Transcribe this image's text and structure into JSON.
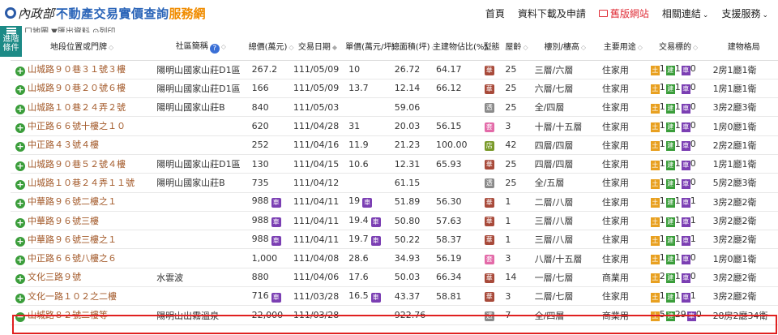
{
  "header": {
    "org": "內政部",
    "title": "不動產交易實價查詢",
    "subtitle": "服務網",
    "nav": [
      {
        "label": "首頁"
      },
      {
        "label": "資料下載及申請"
      },
      {
        "label": "舊版網站"
      },
      {
        "label": "相關連結"
      },
      {
        "label": "支援服務"
      }
    ]
  },
  "filter_tab": {
    "label": "進階條件"
  },
  "toolbar": {
    "label": "口地圖  ▼匯出資料  ⊙列印"
  },
  "columns": [
    "地段位置或門牌",
    "社區簡稱",
    "總價(萬元)",
    "交易日期",
    "單價(萬元/坪)",
    "總面積(坪)",
    "主建物佔比(%)",
    "型態",
    "屋齡",
    "樓別/樓高",
    "主要用途",
    "交易標的",
    "建物格局"
  ],
  "rows": [
    {
      "addr": "山城路９０巷３１號３樓",
      "community": "陽明山國家山莊D1區",
      "price": "267.2",
      "price_car": false,
      "date": "111/05/09",
      "unit": "10",
      "unit_car": false,
      "area": "26.72",
      "ratio": "64.17",
      "type": "華",
      "age": "25",
      "floor": "三層/六層",
      "use": "住家用",
      "t_land": "1",
      "t_bld": "1",
      "t_car": "0",
      "layout": "2房1廳1衛"
    },
    {
      "addr": "山城路９０巷２０號６樓",
      "community": "陽明山國家山莊D1區",
      "price": "166",
      "price_car": false,
      "date": "111/05/09",
      "unit": "13.7",
      "unit_car": false,
      "area": "12.14",
      "ratio": "66.12",
      "type": "華",
      "age": "25",
      "floor": "六層/七層",
      "use": "住家用",
      "t_land": "1",
      "t_bld": "1",
      "t_car": "0",
      "layout": "1房1廳1衛"
    },
    {
      "addr": "山城路１０巷２４弄２號",
      "community": "陽明山國家山莊B",
      "price": "840",
      "price_car": false,
      "date": "111/05/03",
      "unit": "",
      "unit_car": false,
      "area": "59.06",
      "ratio": "",
      "type": "透",
      "age": "25",
      "floor": "全/四層",
      "use": "住家用",
      "t_land": "1",
      "t_bld": "1",
      "t_car": "0",
      "layout": "3房2廳3衛"
    },
    {
      "addr": "中正路６６號十樓之１０",
      "community": "",
      "price": "620",
      "price_car": false,
      "date": "111/04/28",
      "unit": "31",
      "unit_car": false,
      "area": "20.03",
      "ratio": "56.15",
      "type": "套",
      "age": "3",
      "floor": "十層/十五層",
      "use": "住家用",
      "t_land": "1",
      "t_bld": "1",
      "t_car": "0",
      "layout": "1房0廳1衛"
    },
    {
      "addr": "中正路４３號４樓",
      "community": "",
      "price": "252",
      "price_car": false,
      "date": "111/04/16",
      "unit": "11.9",
      "unit_car": false,
      "area": "21.23",
      "ratio": "100.00",
      "type": "店",
      "age": "42",
      "floor": "四層/四層",
      "use": "住家用",
      "t_land": "1",
      "t_bld": "1",
      "t_car": "0",
      "layout": "2房2廳1衛"
    },
    {
      "addr": "山城路９０巷５２號４樓",
      "community": "陽明山國家山莊D1區",
      "price": "130",
      "price_car": false,
      "date": "111/04/15",
      "unit": "10.6",
      "unit_car": false,
      "area": "12.31",
      "ratio": "65.93",
      "type": "華",
      "age": "25",
      "floor": "四層/四層",
      "use": "住家用",
      "t_land": "1",
      "t_bld": "1",
      "t_car": "0",
      "layout": "1房1廳1衛"
    },
    {
      "addr": "山城路１０巷２４弄１１號",
      "community": "陽明山國家山莊B",
      "price": "735",
      "price_car": false,
      "date": "111/04/12",
      "unit": "",
      "unit_car": false,
      "area": "61.15",
      "ratio": "",
      "type": "透",
      "age": "25",
      "floor": "全/五層",
      "use": "住家用",
      "t_land": "1",
      "t_bld": "1",
      "t_car": "0",
      "layout": "5房2廳3衛"
    },
    {
      "addr": "中華路９６號二樓之１",
      "community": "",
      "price": "988",
      "price_car": true,
      "date": "111/04/11",
      "unit": "19",
      "unit_car": true,
      "area": "51.89",
      "ratio": "56.30",
      "type": "華",
      "age": "1",
      "floor": "二層/八層",
      "use": "住家用",
      "t_land": "1",
      "t_bld": "1",
      "t_car": "1",
      "layout": "3房2廳2衛"
    },
    {
      "addr": "中華路９６號三樓",
      "community": "",
      "price": "988",
      "price_car": true,
      "date": "111/04/11",
      "unit": "19.4",
      "unit_car": true,
      "area": "50.80",
      "ratio": "57.63",
      "type": "華",
      "age": "1",
      "floor": "三層/八層",
      "use": "住家用",
      "t_land": "1",
      "t_bld": "1",
      "t_car": "1",
      "layout": "3房2廳2衛"
    },
    {
      "addr": "中華路９６號三樓之１",
      "community": "",
      "price": "988",
      "price_car": true,
      "date": "111/04/11",
      "unit": "19.7",
      "unit_car": true,
      "area": "50.22",
      "ratio": "58.37",
      "type": "華",
      "age": "1",
      "floor": "三層/八層",
      "use": "住家用",
      "t_land": "1",
      "t_bld": "1",
      "t_car": "1",
      "layout": "3房2廳2衛"
    },
    {
      "addr": "中正路６６號八樓之６",
      "community": "",
      "price": "1,000",
      "price_car": false,
      "date": "111/04/08",
      "unit": "28.6",
      "unit_car": false,
      "area": "34.93",
      "ratio": "56.19",
      "type": "套",
      "age": "3",
      "floor": "八層/十五層",
      "use": "住家用",
      "t_land": "1",
      "t_bld": "1",
      "t_car": "0",
      "layout": "1房0廳1衛"
    },
    {
      "addr": "文化三路９號",
      "community": "水雲波",
      "price": "880",
      "price_car": false,
      "date": "111/04/06",
      "unit": "17.6",
      "unit_car": false,
      "area": "50.03",
      "ratio": "66.34",
      "type": "華",
      "age": "14",
      "floor": "一層/七層",
      "use": "商業用",
      "t_land": "2",
      "t_bld": "1",
      "t_car": "0",
      "layout": "3房2廳2衛"
    },
    {
      "addr": "文化一路１０２之二樓",
      "community": "",
      "price": "716",
      "price_car": true,
      "date": "111/03/28",
      "unit": "16.5",
      "unit_car": true,
      "area": "43.37",
      "ratio": "58.81",
      "type": "華",
      "age": "3",
      "floor": "二層/七層",
      "use": "住家用",
      "t_land": "1",
      "t_bld": "1",
      "t_car": "1",
      "layout": "3房2廳2衛"
    },
    {
      "addr": "山城路８２號二樓等",
      "community": "陽明山出霧溫泉",
      "price": "22,000",
      "price_car": false,
      "date": "111/03/28",
      "unit": "",
      "unit_car": false,
      "area": "922.76",
      "ratio": "",
      "type": "透",
      "age": "7",
      "floor": "全/四層",
      "use": "商業用",
      "t_land": "5",
      "t_bld": "29",
      "t_car": "0",
      "layout": "28房2廳34衛",
      "highlight": true
    }
  ]
}
